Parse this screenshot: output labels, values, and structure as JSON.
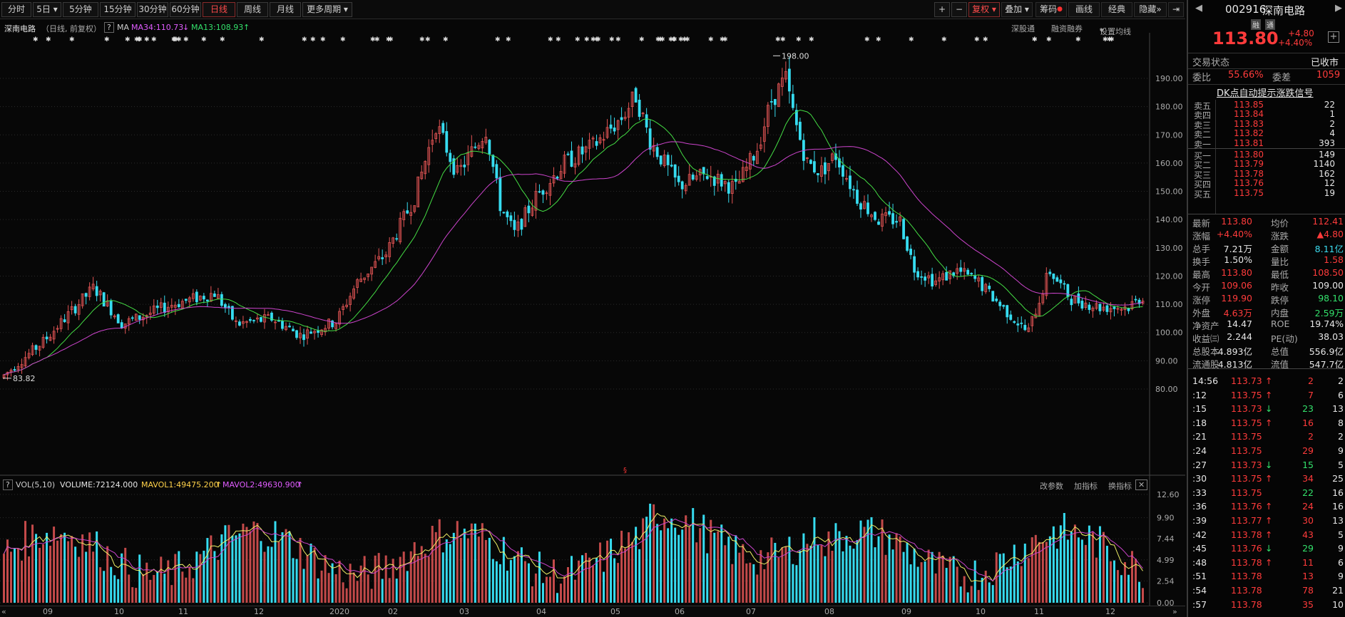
{
  "toolbar": {
    "left": [
      "分时",
      "5日",
      "5分钟",
      "15分钟",
      "30分钟",
      "60分钟",
      "日线",
      "周线",
      "月线",
      "更多周期"
    ],
    "active": "日线",
    "dropdown_marks": [
      "5日",
      "更多周期"
    ],
    "right": [
      "复权",
      "叠加",
      "筹码",
      "画线",
      "经典",
      "隐藏"
    ],
    "plus": "+",
    "minus": "−"
  },
  "chart_header": {
    "name": "深南电路",
    "period_info": "（日线, 前复权）",
    "help": "?",
    "ma_label": "MA",
    "ma34": "MA34:110.73",
    "ma34_arrow": "↓",
    "ma13": "MA13:108.93",
    "ma13_arrow": "↑",
    "links": [
      "深股通",
      "融资融券",
      "设置均线"
    ]
  },
  "price_axis": {
    "labels": [
      "190.00",
      "180.00",
      "170.00",
      "160.00",
      "150.00",
      "140.00",
      "130.00",
      "120.00",
      "110.00",
      "100.00",
      "90.00",
      "80.00"
    ]
  },
  "annotations": {
    "high": "198.00",
    "low": "83.82"
  },
  "volume_header": {
    "help": "?",
    "name": "VOL(5,10)",
    "volume": "VOLUME:72124.000",
    "mavol1": "MAVOL1:49475.200",
    "mavol2": "MAVOL2:49630.900",
    "links": [
      "改参数",
      "加指标",
      "换指标"
    ]
  },
  "volume_axis": {
    "labels": [
      "12.60",
      "9.90",
      "7.44",
      "4.99",
      "2.54",
      "0.00"
    ]
  },
  "x_axis": {
    "labels": [
      "09",
      "10",
      "11",
      "12",
      "2020",
      "02",
      "03",
      "04",
      "05",
      "06",
      "07",
      "08",
      "09",
      "10",
      "11",
      "12"
    ]
  },
  "colors": {
    "up": "#e25454",
    "down": "#36dcf0",
    "ma13": "#44dd44",
    "ma34": "#cc44cc",
    "mavol1": "#eeee66",
    "mavol2": "#cc44cc",
    "bg": "#070707"
  },
  "stock": {
    "code": "002916",
    "name": "深南电路",
    "tags": [
      "融",
      "通"
    ],
    "price": "113.80",
    "change": "+4.80",
    "change_pct": "+4.40%"
  },
  "status": {
    "label": "交易状态",
    "value": "已收市"
  },
  "ratio": {
    "weibi_label": "委比",
    "weibi": "55.66%",
    "weicha_label": "委差",
    "weicha": "1059"
  },
  "signal_link": "DK点自动提示涨跌信号",
  "order_book": {
    "asks": [
      {
        "label": "卖五",
        "price": "113.85",
        "vol": "22"
      },
      {
        "label": "卖四",
        "price": "113.84",
        "vol": "1"
      },
      {
        "label": "卖三",
        "price": "113.83",
        "vol": "2"
      },
      {
        "label": "卖二",
        "price": "113.82",
        "vol": "4"
      },
      {
        "label": "卖一",
        "price": "113.81",
        "vol": "393"
      }
    ],
    "bids": [
      {
        "label": "买一",
        "price": "113.80",
        "vol": "149"
      },
      {
        "label": "买二",
        "price": "113.79",
        "vol": "1140"
      },
      {
        "label": "买三",
        "price": "113.78",
        "vol": "162"
      },
      {
        "label": "买四",
        "price": "113.76",
        "vol": "12"
      },
      {
        "label": "买五",
        "price": "113.75",
        "vol": "19"
      }
    ]
  },
  "quote": [
    {
      "l1": "最新",
      "v1": "113.80",
      "c1": "red",
      "l2": "均价",
      "v2": "112.41",
      "c2": "red"
    },
    {
      "l1": "涨幅",
      "v1": "+4.40%",
      "c1": "red",
      "l2": "涨跌",
      "v2": "▲4.80",
      "c2": "red"
    },
    {
      "l1": "总手",
      "v1": "7.21万",
      "c1": "wht",
      "l2": "金额",
      "v2": "8.11亿",
      "c2": "cyan"
    },
    {
      "l1": "换手",
      "v1": "1.50%",
      "c1": "wht",
      "l2": "量比",
      "v2": "1.58",
      "c2": "red"
    },
    {
      "l1": "最高",
      "v1": "113.80",
      "c1": "red",
      "l2": "最低",
      "v2": "108.50",
      "c2": "red"
    },
    {
      "l1": "今开",
      "v1": "109.06",
      "c1": "red",
      "l2": "昨收",
      "v2": "109.00",
      "c2": "wht"
    },
    {
      "l1": "涨停",
      "v1": "119.90",
      "c1": "red",
      "l2": "跌停",
      "v2": "98.10",
      "c2": "grn"
    },
    {
      "l1": "外盘",
      "v1": "4.63万",
      "c1": "red",
      "l2": "内盘",
      "v2": "2.59万",
      "c2": "grn"
    },
    {
      "l1": "净资产",
      "v1": "14.47",
      "c1": "wht",
      "l2": "ROE",
      "v2": "19.74%",
      "c2": "wht"
    },
    {
      "l1": "收益㈢",
      "v1": "2.244",
      "c1": "wht",
      "l2": "PE(动)",
      "v2": "38.03",
      "c2": "wht"
    },
    {
      "l1": "总股本",
      "v1": "4.893亿",
      "c1": "wht",
      "l2": "总值",
      "v2": "556.9亿",
      "c2": "wht"
    },
    {
      "l1": "流通股",
      "v1": "4.813亿",
      "c1": "wht",
      "l2": "流值",
      "v2": "547.7亿",
      "c2": "wht"
    }
  ],
  "ticks": [
    {
      "t": "14:56",
      "p": "113.73",
      "a": "↑",
      "ac": "red",
      "v": "2",
      "vc": "red",
      "n": "2"
    },
    {
      "t": ":12",
      "p": "113.75",
      "a": "↑",
      "ac": "red",
      "v": "7",
      "vc": "red",
      "n": "6"
    },
    {
      "t": ":15",
      "p": "113.73",
      "a": "↓",
      "ac": "grn",
      "v": "23",
      "vc": "grn",
      "n": "13"
    },
    {
      "t": ":18",
      "p": "113.75",
      "a": "↑",
      "ac": "red",
      "v": "16",
      "vc": "red",
      "n": "8"
    },
    {
      "t": ":21",
      "p": "113.75",
      "a": "",
      "ac": "red",
      "v": "2",
      "vc": "red",
      "n": "2"
    },
    {
      "t": ":24",
      "p": "113.75",
      "a": "",
      "ac": "red",
      "v": "29",
      "vc": "red",
      "n": "9"
    },
    {
      "t": ":27",
      "p": "113.73",
      "a": "↓",
      "ac": "grn",
      "v": "15",
      "vc": "grn",
      "n": "5"
    },
    {
      "t": ":30",
      "p": "113.75",
      "a": "↑",
      "ac": "red",
      "v": "34",
      "vc": "red",
      "n": "25"
    },
    {
      "t": ":33",
      "p": "113.75",
      "a": "",
      "ac": "red",
      "v": "22",
      "vc": "grn",
      "n": "16"
    },
    {
      "t": ":36",
      "p": "113.76",
      "a": "↑",
      "ac": "red",
      "v": "24",
      "vc": "red",
      "n": "16"
    },
    {
      "t": ":39",
      "p": "113.77",
      "a": "↑",
      "ac": "red",
      "v": "30",
      "vc": "red",
      "n": "13"
    },
    {
      "t": ":42",
      "p": "113.78",
      "a": "↑",
      "ac": "red",
      "v": "43",
      "vc": "red",
      "n": "5"
    },
    {
      "t": ":45",
      "p": "113.76",
      "a": "↓",
      "ac": "grn",
      "v": "29",
      "vc": "grn",
      "n": "9"
    },
    {
      "t": ":48",
      "p": "113.78",
      "a": "↑",
      "ac": "red",
      "v": "11",
      "vc": "red",
      "n": "6"
    },
    {
      "t": ":51",
      "p": "113.78",
      "a": "",
      "ac": "red",
      "v": "13",
      "vc": "red",
      "n": "9"
    },
    {
      "t": ":54",
      "p": "113.78",
      "a": "",
      "ac": "red",
      "v": "78",
      "vc": "red",
      "n": "21"
    },
    {
      "t": ":57",
      "p": "113.78",
      "a": "",
      "ac": "red",
      "v": "35",
      "vc": "red",
      "n": "10"
    }
  ]
}
